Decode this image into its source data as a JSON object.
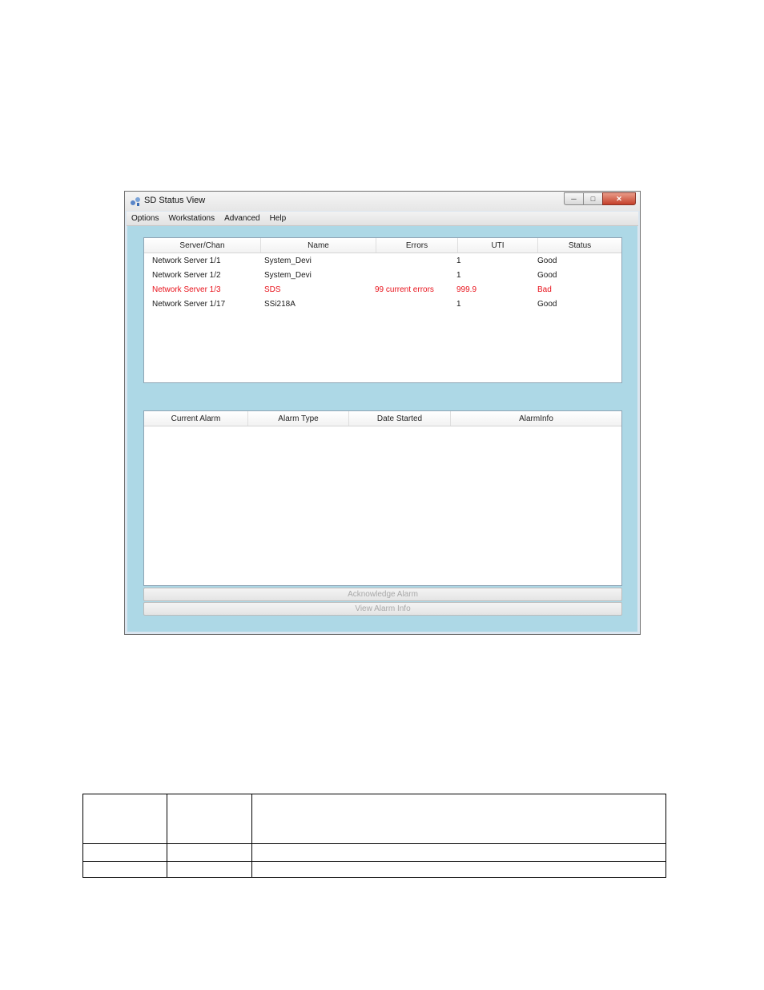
{
  "window": {
    "title": "SD Status View"
  },
  "menu": [
    "Options",
    "Workstations",
    "Advanced",
    "Help"
  ],
  "servers": {
    "columns": [
      "Server/Chan",
      "Name",
      "Errors",
      "UTI",
      "Status"
    ],
    "rows": [
      {
        "server": "Network Server 1/1",
        "name": "System_Devi",
        "errors": "",
        "uti": "1",
        "status": "Good"
      },
      {
        "server": "Network Server 1/2",
        "name": "System_Devi",
        "errors": "",
        "uti": "1",
        "status": "Good"
      },
      {
        "server": "Network Server 1/3",
        "name": "SDS",
        "errors": "99 current errors",
        "uti": "999.9",
        "status": "Bad"
      },
      {
        "server": "Network Server 1/17",
        "name": "SSi218A",
        "errors": "",
        "uti": "1",
        "status": "Good"
      }
    ]
  },
  "alarms": {
    "columns": [
      "Current Alarm",
      "Alarm Type",
      "Date Started",
      "AlarmInfo"
    ],
    "rows": []
  },
  "buttons": {
    "acknowledge": "Acknowledge Alarm",
    "view_info": "View Alarm Info"
  },
  "colors": {
    "error_row": "#e8121b",
    "client_bg": "#add8e6",
    "close_button": "#c4402a"
  }
}
